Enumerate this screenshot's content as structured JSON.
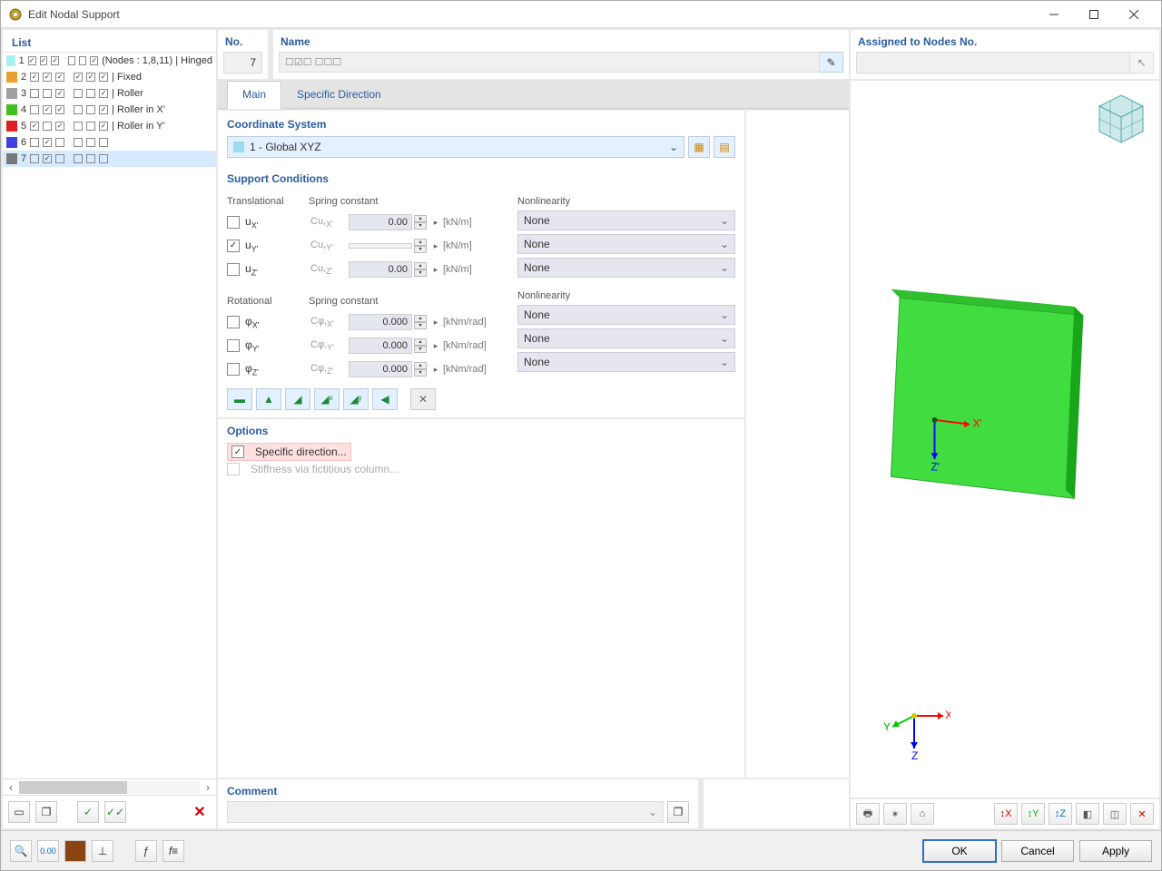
{
  "window": {
    "title": "Edit Nodal Support"
  },
  "left": {
    "title": "List",
    "items": [
      {
        "n": "1",
        "color": "#a8f0f0",
        "c": [
          "ck",
          "ck",
          "ck",
          "",
          "",
          "ck"
        ],
        "label": "(Nodes : 1,8,11) | Hinged"
      },
      {
        "n": "2",
        "color": "#e8a030",
        "c": [
          "ck",
          "ck",
          "ck",
          "ck",
          "ck",
          "ck"
        ],
        "label": "| Fixed"
      },
      {
        "n": "3",
        "color": "#a0a0a0",
        "c": [
          "",
          "",
          "ck",
          "",
          "",
          "ck"
        ],
        "label": "| Roller"
      },
      {
        "n": "4",
        "color": "#40c020",
        "c": [
          "",
          "ck",
          "ck",
          "",
          "",
          "ck"
        ],
        "label": "| Roller in X'"
      },
      {
        "n": "5",
        "color": "#e02020",
        "c": [
          "ck",
          "",
          "ck",
          "",
          "",
          "ck"
        ],
        "label": "| Roller in Y'"
      },
      {
        "n": "6",
        "color": "#4040e0",
        "c": [
          "",
          "ck",
          "",
          "",
          "",
          ""
        ],
        "label": ""
      },
      {
        "n": "7",
        "color": "#787878",
        "c": [
          "",
          "ck",
          "",
          "",
          "",
          ""
        ],
        "label": "",
        "sel": true
      }
    ]
  },
  "header": {
    "noLabel": "No.",
    "noValue": "7",
    "nameLabel": "Name",
    "nameValue": "☐☑☐  ☐☐☐",
    "assignedLabel": "Assigned to Nodes No."
  },
  "tabs": {
    "main": "Main",
    "specific": "Specific Direction"
  },
  "cs": {
    "title": "Coordinate System",
    "value": "1 - Global XYZ"
  },
  "support": {
    "title": "Support Conditions",
    "trans": "Translational",
    "spring": "Spring constant",
    "nonlin": "Nonlinearity",
    "rot": "Rotational",
    "rows_t": [
      {
        "lab": "uX'",
        "c": false,
        "clab": "Cu,X'",
        "val": "0.00",
        "unit": "[kN/m]"
      },
      {
        "lab": "uY'",
        "c": true,
        "clab": "Cu,Y'",
        "val": "",
        "unit": "[kN/m]"
      },
      {
        "lab": "uZ'",
        "c": false,
        "clab": "Cu,Z'",
        "val": "0.00",
        "unit": "[kN/m]"
      }
    ],
    "rows_r": [
      {
        "lab": "φX'",
        "c": false,
        "clab": "Cφ,X'",
        "val": "0.000",
        "unit": "[kNm/rad]"
      },
      {
        "lab": "φY'",
        "c": false,
        "clab": "Cφ,Y'",
        "val": "0.000",
        "unit": "[kNm/rad]"
      },
      {
        "lab": "φZ'",
        "c": false,
        "clab": "Cφ,Z'",
        "val": "0.000",
        "unit": "[kNm/rad]"
      }
    ],
    "none": "None"
  },
  "options": {
    "title": "Options",
    "specific": "Specific direction...",
    "stiffness": "Stiffness via fictitious column..."
  },
  "comment": {
    "title": "Comment"
  },
  "axes": {
    "x": "X",
    "y": "Y",
    "z": "Z",
    "xp": "X'",
    "zp": "Z'"
  },
  "buttons": {
    "ok": "OK",
    "cancel": "Cancel",
    "apply": "Apply"
  }
}
